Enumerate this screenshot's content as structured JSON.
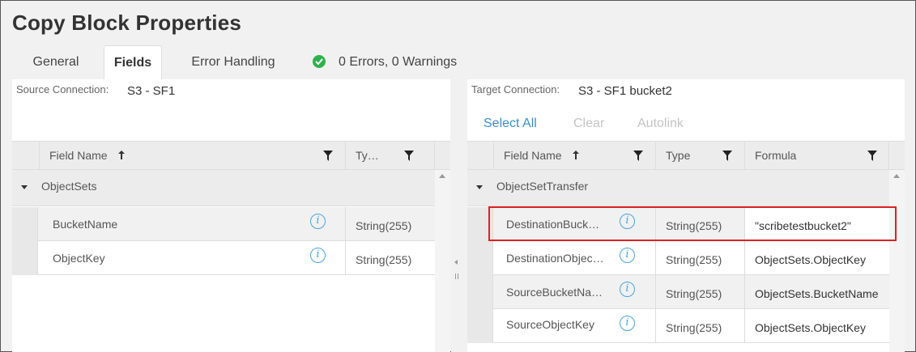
{
  "title": "Copy Block Properties",
  "tabs": [
    {
      "label": "General",
      "active": false
    },
    {
      "label": "Fields",
      "active": true
    },
    {
      "label": "Error Handling",
      "active": false
    }
  ],
  "status": {
    "text": "0 Errors, 0 Warnings",
    "icon": "check-circle-icon",
    "color": "#2eb14c"
  },
  "source": {
    "connection_label": "Source Connection:",
    "connection_value": "S3 - SF1",
    "columns": {
      "field_name": "Field Name",
      "type": "Ty…"
    },
    "group": "ObjectSets",
    "rows": [
      {
        "name": "BucketName",
        "type": "String(255)"
      },
      {
        "name": "ObjectKey",
        "type": "String(255)"
      }
    ]
  },
  "target": {
    "connection_label": "Target Connection:",
    "connection_value": "S3 - SF1 bucket2",
    "toolbar": {
      "select_all": "Select All",
      "clear": "Clear",
      "autolink": "Autolink"
    },
    "columns": {
      "field_name": "Field Name",
      "type": "Type",
      "formula": "Formula"
    },
    "group": "ObjectSetTransfer",
    "rows": [
      {
        "name": "DestinationBuck…",
        "type": "String(255)",
        "formula": "\"scribetestbucket2\""
      },
      {
        "name": "DestinationObjec…",
        "type": "String(255)",
        "formula": "ObjectSets.ObjectKey"
      },
      {
        "name": "SourceBucketNa…",
        "type": "String(255)",
        "formula": "ObjectSets.BucketName"
      },
      {
        "name": "SourceObjectKey",
        "type": "String(255)",
        "formula": "ObjectSets.ObjectKey"
      }
    ]
  },
  "colors": {
    "accent": "#3a8fc7",
    "disabled": "#c4c4c4",
    "highlight": "#dd2222",
    "info": "#4aa3df"
  },
  "sort_icon": "sort-ascending-icon",
  "filter_icon": "filter-icon",
  "info_icon_glyph": "i"
}
